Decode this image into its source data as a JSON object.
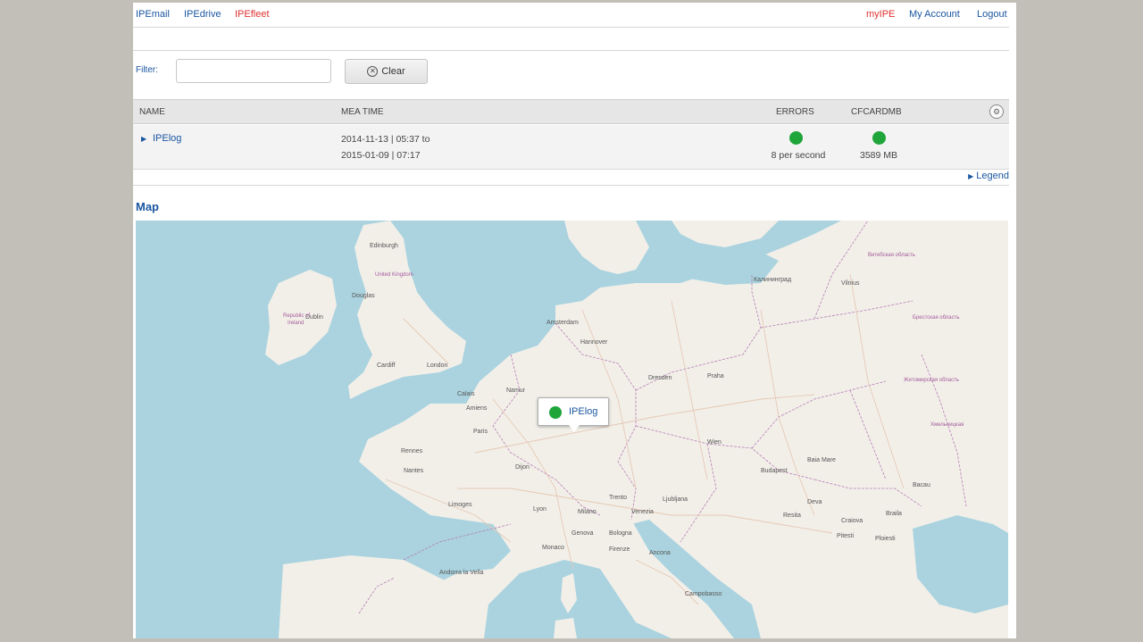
{
  "nav": {
    "left": [
      {
        "label": "IPEmail",
        "active": false
      },
      {
        "label": "IPEdrive",
        "active": false
      },
      {
        "label": "IPEfleet",
        "active": true
      }
    ],
    "right": [
      {
        "label": "myIPE",
        "active": true
      },
      {
        "label": "My Account",
        "active": false
      },
      {
        "label": "Logout",
        "active": false
      }
    ]
  },
  "filter": {
    "label": "Filter:",
    "value": "",
    "placeholder": "",
    "clear_label": "Clear",
    "clear_icon": "clear-circle-icon"
  },
  "table": {
    "columns": {
      "name": "NAME",
      "mea_time": "MEA TIME",
      "errors": "ERRORS",
      "cfcardmb": "CFCARDMB"
    },
    "settings_icon": "settings-icon",
    "rows": [
      {
        "name": "IPElog",
        "time_from": "2014-11-13 | 05:37 to",
        "time_to": "2015-01-09 | 07:17",
        "errors_text": "8 per second",
        "errors_status": "ok",
        "cfcard_text": "3589 MB",
        "cfcard_status": "ok"
      }
    ]
  },
  "legend_label": "Legend",
  "map": {
    "title": "Map",
    "marker_label": "IPElog",
    "cities": [
      "Edinburgh",
      "Douglas",
      "Cardiff",
      "London",
      "Dublin",
      "Amsterdam",
      "Hannover",
      "Dresden",
      "Calais",
      "Namur",
      "Amiens",
      "Paris",
      "Rennes",
      "Nantes",
      "Dijon",
      "Limoges",
      "Lyon",
      "Trento",
      "Venezia",
      "Ljubljana",
      "Milano",
      "Genova",
      "Bologna",
      "Firenze",
      "Ancona",
      "Monaco",
      "Praha",
      "Wien",
      "Budapest",
      "Baia Mare",
      "Deva",
      "Resita",
      "Craiova",
      "Pitesti",
      "Ploiesti",
      "Braila",
      "Bacau",
      "Vilnius",
      "Калининград",
      "Campobasso",
      "Andorra la Vella"
    ],
    "colors": {
      "water": "#aad3df",
      "land": "#f2efe9",
      "border": "#b67eb5",
      "road": "#e6c9b5"
    }
  },
  "colors": {
    "accent": "#1a56a0",
    "active": "#e03030",
    "ok": "#1fa53a"
  }
}
